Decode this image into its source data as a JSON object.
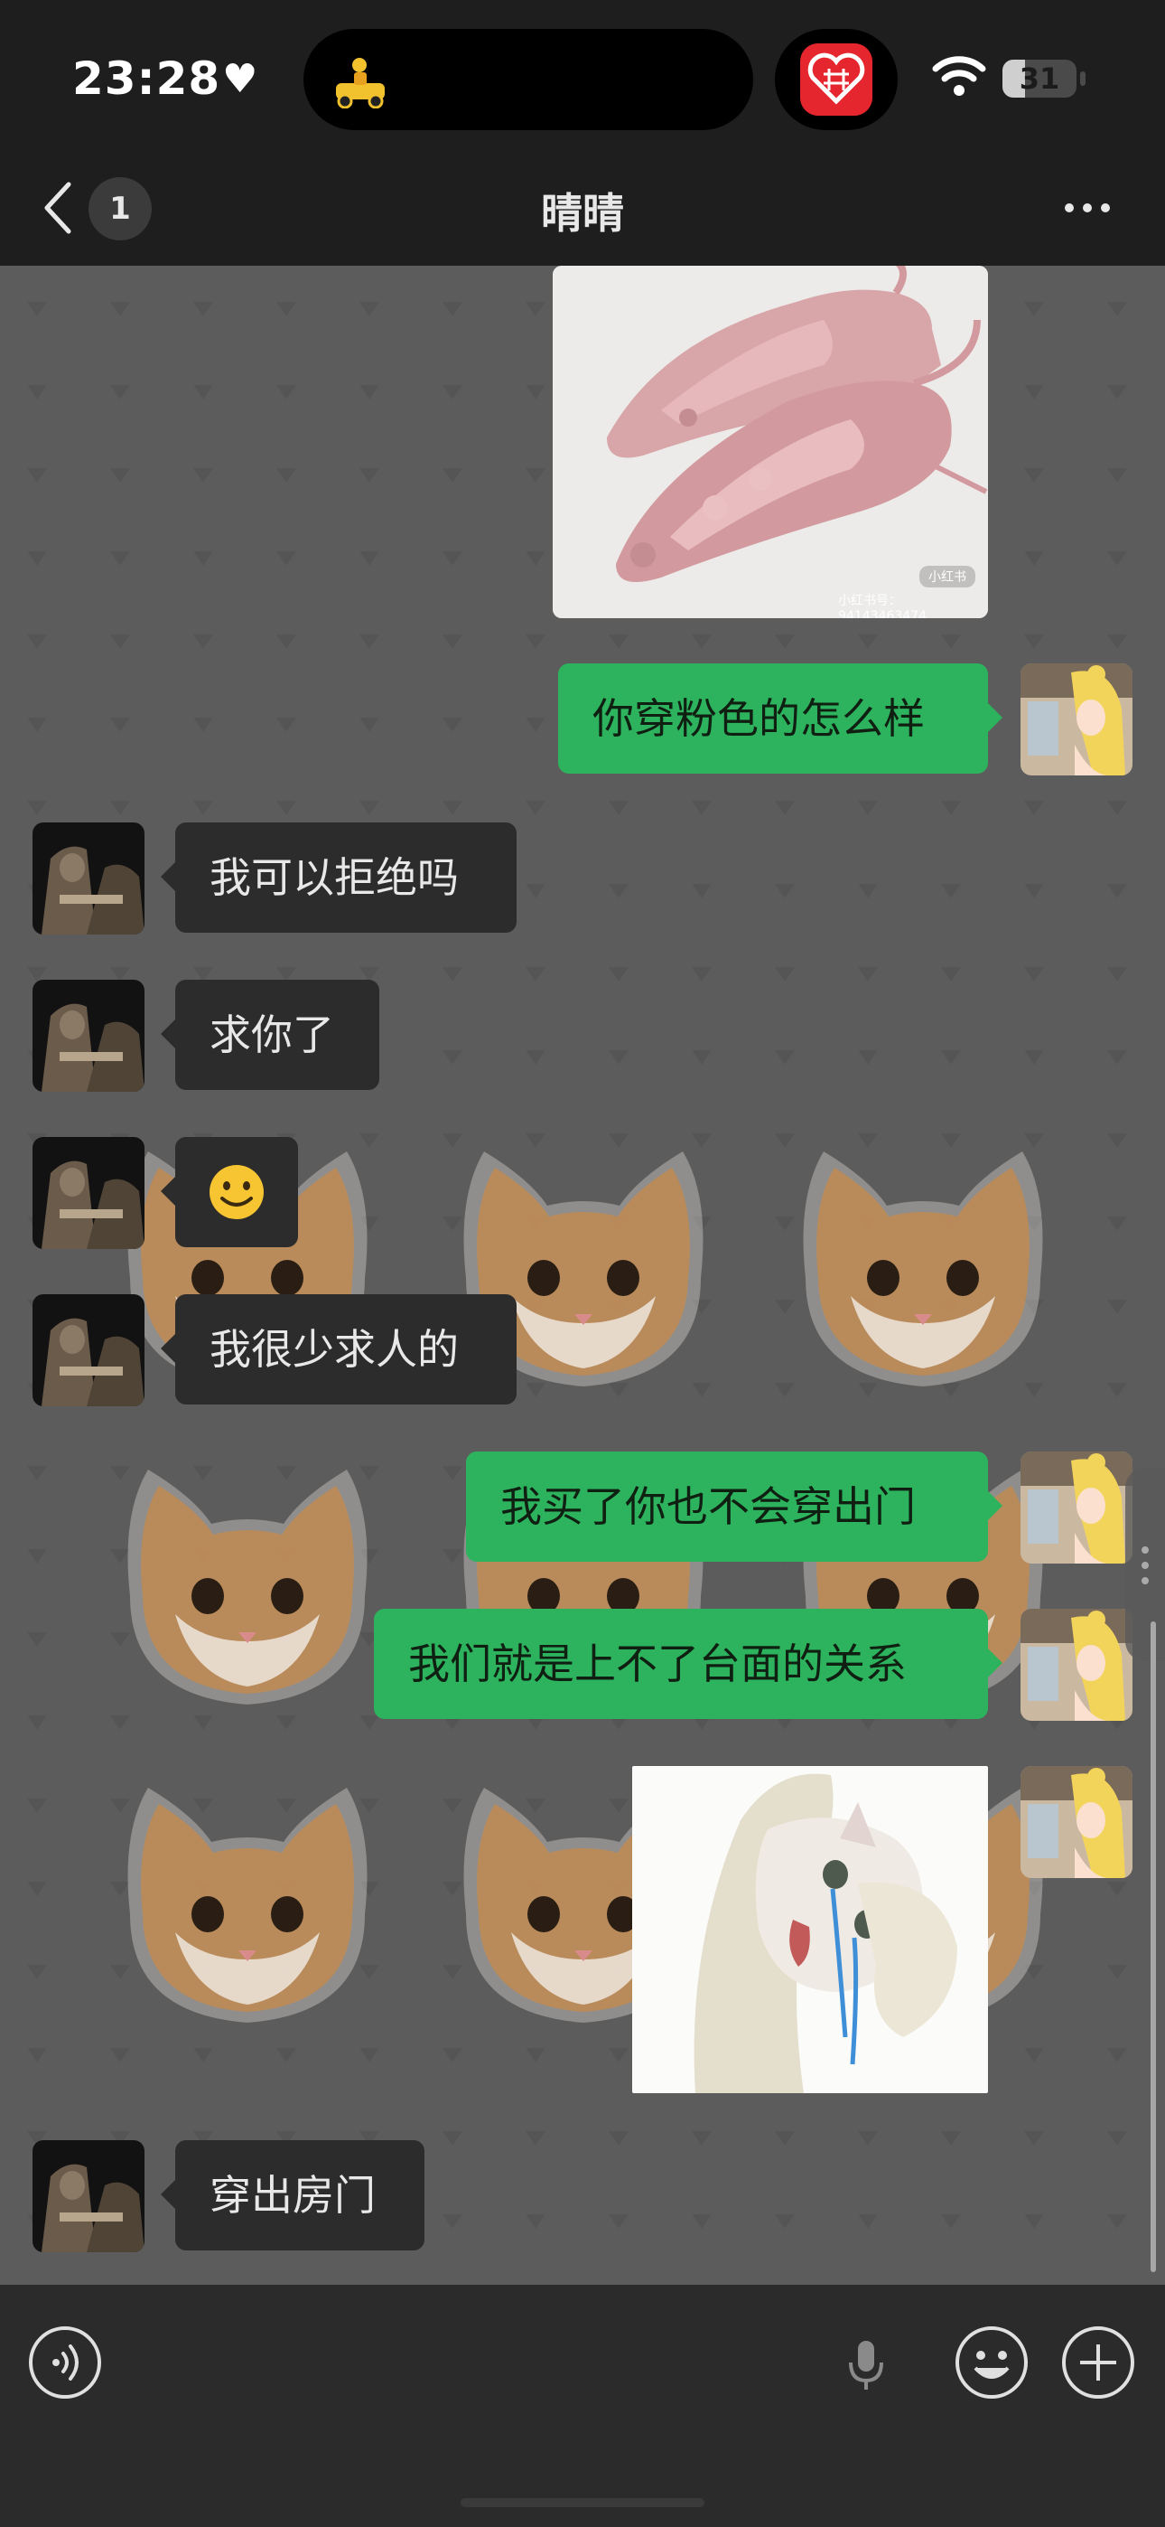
{
  "status_bar": {
    "time": "23:28",
    "battery": "31",
    "battery_level": 0.31
  },
  "nav": {
    "unread_count": "1",
    "title": "晴晴"
  },
  "messages": [
    {
      "side": "out",
      "type": "image",
      "subject": "pink mouse-shaped pointed flats",
      "watermark_badge": "小红书",
      "watermark_id": "小红书号：94143463474"
    },
    {
      "side": "out",
      "type": "text",
      "text": "你穿粉色的怎么样"
    },
    {
      "side": "in",
      "type": "text",
      "text": "我可以拒绝吗"
    },
    {
      "side": "in",
      "type": "text",
      "text": "求你了"
    },
    {
      "side": "in",
      "type": "emoji",
      "emoji_name": "smile-emoji"
    },
    {
      "side": "in",
      "type": "text",
      "text": "我很少求人的"
    },
    {
      "side": "out",
      "type": "text",
      "text": "我买了你也不会穿出门"
    },
    {
      "side": "out",
      "type": "text",
      "text": "我们就是上不了台面的关系"
    },
    {
      "side": "out",
      "type": "sticker",
      "subject": "crying cat sticker"
    },
    {
      "side": "in",
      "type": "text",
      "text": "穿出房门"
    }
  ],
  "input_bar": {
    "placeholder": "",
    "icons": [
      "voice-icon",
      "microphone-icon",
      "emoji-icon",
      "plus-icon"
    ]
  },
  "colors": {
    "outgoing_bubble": "#2db35d",
    "incoming_bubble": "#2c2c2c",
    "chat_background": "#5c5c5c",
    "bar_background": "#1e1e1e"
  }
}
